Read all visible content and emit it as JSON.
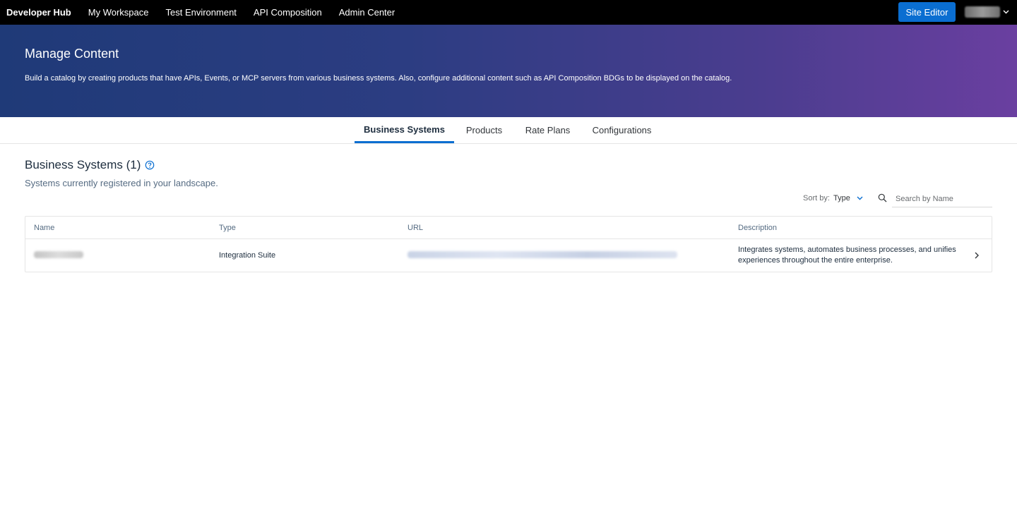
{
  "topbar": {
    "brand": "Developer Hub",
    "links": [
      "My Workspace",
      "Test Environment",
      "API Composition",
      "Admin Center"
    ],
    "site_editor_label": "Site Editor",
    "user_icon": "chevron-down-icon"
  },
  "hero": {
    "title": "Manage Content",
    "description": "Build a catalog by creating products that have APIs, Events, or MCP servers from various business systems. Also, configure additional content such as API Composition BDGs to be displayed on the catalog."
  },
  "tabs": [
    {
      "label": "Business Systems",
      "active": true
    },
    {
      "label": "Products",
      "active": false
    },
    {
      "label": "Rate Plans",
      "active": false
    },
    {
      "label": "Configurations",
      "active": false
    }
  ],
  "section": {
    "title": "Business Systems (1)",
    "subtitle": "Systems currently registered in your landscape.",
    "help_icon": "question-circle-icon"
  },
  "toolbar": {
    "sort_label": "Sort by:",
    "sort_value": "Type",
    "search_placeholder": "Search by Name",
    "search_value": ""
  },
  "table": {
    "columns": [
      "Name",
      "Type",
      "URL",
      "Description"
    ],
    "rows": [
      {
        "type": "Integration Suite",
        "description": "Integrates systems, automates business processes, and unifies experiences throughout the entire enterprise."
      }
    ]
  },
  "colors": {
    "accent": "#0a6ed1",
    "topbar": "#000000",
    "hero_start": "#1f3a78",
    "hero_end": "#6a3fa0"
  }
}
